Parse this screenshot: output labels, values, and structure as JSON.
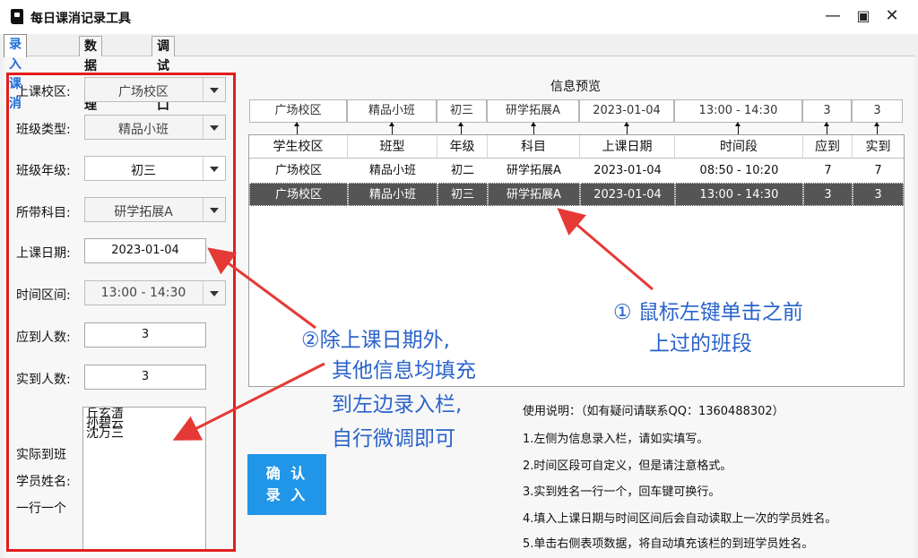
{
  "window": {
    "title": "每日课消记录工具",
    "minimize": "—",
    "maximize": "▣",
    "close": "✕"
  },
  "tabs": [
    {
      "label": "录入课消",
      "active": true
    },
    {
      "label": "数据处理",
      "active": false
    },
    {
      "label": "调试窗口",
      "active": false
    }
  ],
  "form": {
    "campus_label": "上课校区:",
    "campus_value": "广场校区",
    "class_type_label": "班级类型:",
    "class_type_value": "精品小班",
    "grade_label": "班级年级:",
    "grade_value": "初三",
    "subject_label": "所带科目:",
    "subject_value": "研学拓展A",
    "date_label": "上课日期:",
    "date_value": "2023-01-04",
    "time_label": "时间区间:",
    "time_value": "13:00 - 14:30",
    "expected_label": "应到人数:",
    "expected_value": "3",
    "actual_label": "实到人数:",
    "actual_value": "3",
    "names_label_1": "实际到班",
    "names_label_2": "学员姓名:",
    "names_label_3": "一行一个",
    "names_value": "丘玄清\n孙碧云\n沈万三"
  },
  "preview": {
    "title": "信息预览",
    "values": [
      "广场校区",
      "精品小班",
      "初三",
      "研学拓展A",
      "2023-01-04",
      "13:00 - 14:30",
      "3",
      "3"
    ]
  },
  "table": {
    "columns": [
      "学生校区",
      "班型",
      "年级",
      "科目",
      "上课日期",
      "时间段",
      "应到",
      "实到"
    ],
    "rows": [
      [
        "广场校区",
        "精品小班",
        "初二",
        "研学拓展A",
        "2023-01-04",
        "08:50 - 10:20",
        "7",
        "7"
      ],
      [
        "广场校区",
        "精品小班",
        "初三",
        "研学拓展A",
        "2023-01-04",
        "13:00 - 14:30",
        "3",
        "3"
      ]
    ]
  },
  "confirm_button": {
    "line1": "确 认",
    "line2": "录 入"
  },
  "instructions": {
    "title": "使用说明：（如有疑问请联系QQ：1360488302）",
    "items": [
      "1.左侧为信息录入栏，请如实填写。",
      "2.时间区段可自定义，但是请注意格式。",
      "3.实到姓名一行一个，回车键可换行。",
      "4.填入上课日期与时间区间后会自动读取上一次的学员姓名。",
      "5.单击右侧表项数据，将自动填充该栏的到班学员姓名。"
    ]
  },
  "annotations": {
    "callout_right_1": "① 鼠标左键单击之前",
    "callout_right_2": "上过的班段",
    "callout_left_1": "②除上课日期外,",
    "callout_left_2": "其他信息均填充",
    "callout_left_3": "到左边录入栏,",
    "callout_left_4": "自行微调即可",
    "arrow_color": "#e53935"
  },
  "colors": {
    "accent": "#1e6ed8",
    "button": "#2196e8",
    "highlight": "#e31e1e",
    "selected_row": "#555555"
  }
}
